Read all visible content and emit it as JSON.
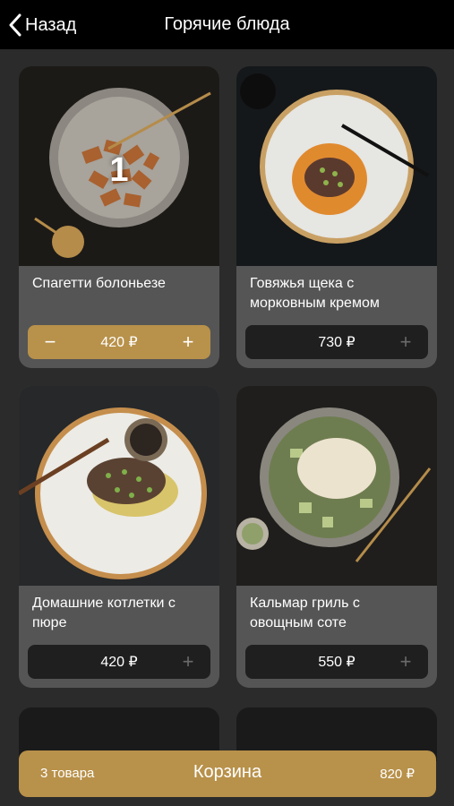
{
  "header": {
    "back_label": "Назад",
    "title": "Горячие блюда"
  },
  "products": [
    {
      "name": "Спагетти болоньезе",
      "price": "420 ₽",
      "quantity": "1",
      "in_cart": true
    },
    {
      "name": "Говяжья щека с морковным кремом",
      "price": "730 ₽",
      "in_cart": false
    },
    {
      "name": "Домашние котлетки с пюре",
      "price": "420 ₽",
      "in_cart": false
    },
    {
      "name": "Кальмар гриль с овощным соте",
      "price": "550 ₽",
      "in_cart": false
    }
  ],
  "controls": {
    "minus": "−",
    "plus": "+"
  },
  "cart": {
    "count_label": "3 товара",
    "label": "Корзина",
    "total": "820 ₽"
  },
  "colors": {
    "accent": "#b8914a",
    "background": "#2b2b2b",
    "card": "#555555",
    "header": "#000000"
  }
}
